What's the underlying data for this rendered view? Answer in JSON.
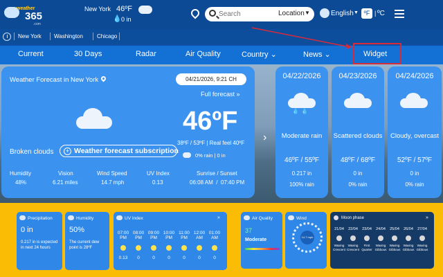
{
  "header": {
    "brand_small": "weather",
    "brand_big": "365",
    "brand_tld": ".com",
    "city": "New York",
    "temp": "46ºF",
    "precip": "0 in",
    "search_placeholder": "Search",
    "location_label": "Location",
    "language": "English",
    "unit_f": "ºF",
    "unit_sep": "|",
    "unit_c": "ºC"
  },
  "saved_locations": [
    "New York",
    "Washington",
    "Chicago"
  ],
  "nav": {
    "current": "Current",
    "days30": "30 Days",
    "radar": "Radar",
    "air_quality": "Air Quality",
    "country": "Country ⌄",
    "news": "News ⌄",
    "widget": "Widget"
  },
  "current": {
    "title": "Weather Forecast in New York",
    "datetime": "04/21/2026, 9:21 CH",
    "full_forecast": "Full forecast »",
    "temp": "46ºF",
    "condition": "Broken clouds",
    "subscribe": "Weather forecast subscription",
    "hilo": "38ºF / 53ºF | Real feel 40ºF",
    "rain": "0% rain | 0 in",
    "stats": {
      "humidity_label": "Humidity",
      "humidity": "48%",
      "vision_label": "Vision",
      "vision": "6.21 miles",
      "wind_label": "Wind Speed",
      "wind": "14.7 mph",
      "uv_label": "UV Index",
      "uv": "0.13",
      "sun_label": "Sunrise / Sunset",
      "sun": "06:08 AM  /  07:40 PM"
    }
  },
  "forecast": [
    {
      "date": "04/22/2026",
      "cond": "Moderate rain",
      "temp": "46ºF / 55ºF",
      "precip": "0.217 in",
      "rain": "100% rain"
    },
    {
      "date": "04/23/2026",
      "cond": "Scattered clouds",
      "temp": "48ºF / 68ºF",
      "precip": "0 in",
      "rain": "0% rain"
    },
    {
      "date": "04/24/2026",
      "cond": "Cloudy, overcast",
      "temp": "52ºF / 57ºF",
      "precip": "0 in",
      "rain": "0% rain"
    }
  ],
  "widgets": {
    "precip_title": "Precipitation",
    "precip_val": "0 in",
    "precip_note": "0.217 in is expected in next 24 hours",
    "humidity_title": "Humidity",
    "humidity_val": "50%",
    "humidity_note": "The current dew point is 28ºF",
    "uv_title": "UV Index",
    "uv_hours": [
      {
        "t": "07:00",
        "p": "PM",
        "v": "0.13"
      },
      {
        "t": "08:00",
        "p": "PM",
        "v": "0"
      },
      {
        "t": "09:00",
        "p": "PM",
        "v": "0"
      },
      {
        "t": "10:00",
        "p": "PM",
        "v": "0"
      },
      {
        "t": "11:00",
        "p": "PM",
        "v": "0"
      },
      {
        "t": "12:00",
        "p": "AM",
        "v": "0"
      },
      {
        "t": "01:00",
        "p": "AM",
        "v": "0"
      }
    ],
    "aq_title": "Air Quality",
    "aq_val": "37",
    "aq_level": "Moderate",
    "wind_title": "Wind",
    "wind_val": "14.7 mph",
    "moon_title": "Moon phase",
    "moon": [
      {
        "d": "21/04",
        "n": "Waxing Crescent"
      },
      {
        "d": "22/04",
        "n": "Waxing Crescent"
      },
      {
        "d": "23/04",
        "n": "First Quarter"
      },
      {
        "d": "24/04",
        "n": "Waxing Gibbous"
      },
      {
        "d": "25/04",
        "n": "Waxing Gibbous"
      },
      {
        "d": "26/04",
        "n": "Waxing Gibbous"
      },
      {
        "d": "27/04",
        "n": "Waxing Gibbous"
      }
    ]
  },
  "colors": {
    "accent": "#1370d5",
    "highlight_box": "#d92a3a",
    "widget_bg": "#fbbc05"
  }
}
